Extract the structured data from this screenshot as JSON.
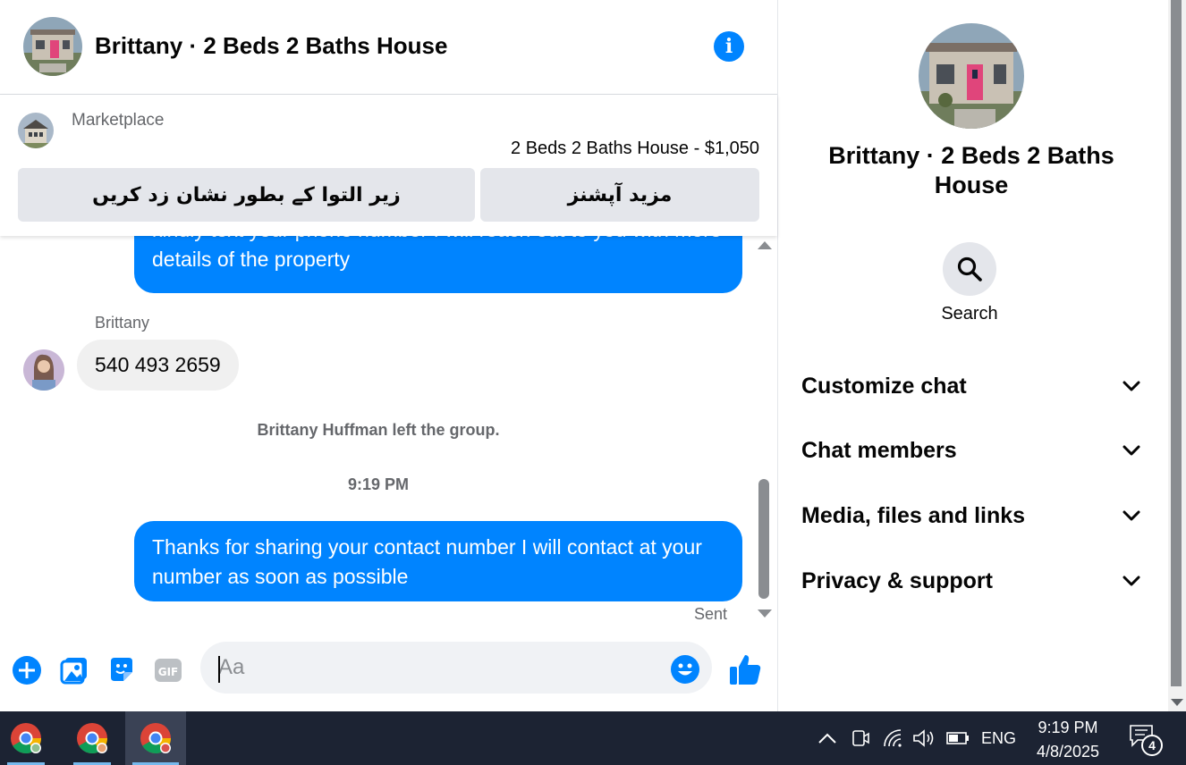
{
  "header": {
    "title": "Brittany · 2 Beds 2 Baths House",
    "info_icon": "info-icon"
  },
  "marketplace": {
    "label": "Marketplace",
    "listing": "2 Beds 2 Baths House - $1,050",
    "mark_button_label": "زیر التوا کے بطور نشان زد کریں",
    "more_options_label": "مزید آپشنز"
  },
  "messages": {
    "outgoing_partial": "kindly text your phone number I will reach out to you with more details of the property",
    "sender_name": "Brittany",
    "incoming": "540 493 2659",
    "system_left": "Brittany Huffman left the group.",
    "timestamp": "9:19 PM",
    "outgoing_last": "Thanks for sharing your contact number I will contact at your number as soon as possible",
    "status": "Sent"
  },
  "composer": {
    "placeholder": "Aa",
    "value": ""
  },
  "info_panel": {
    "title": "Brittany · 2 Beds 2 Baths House",
    "search_label": "Search",
    "sections": [
      {
        "label": "Customize chat"
      },
      {
        "label": "Chat members"
      },
      {
        "label": "Media, files and links"
      },
      {
        "label": "Privacy & support"
      }
    ]
  },
  "taskbar": {
    "language": "ENG",
    "time": "9:19 PM",
    "date": "4/8/2025",
    "notification_count": "4"
  },
  "colors": {
    "messenger_blue": "#0084ff",
    "bubble_incoming": "#f0f0f0",
    "taskbar": "#1c2333"
  }
}
